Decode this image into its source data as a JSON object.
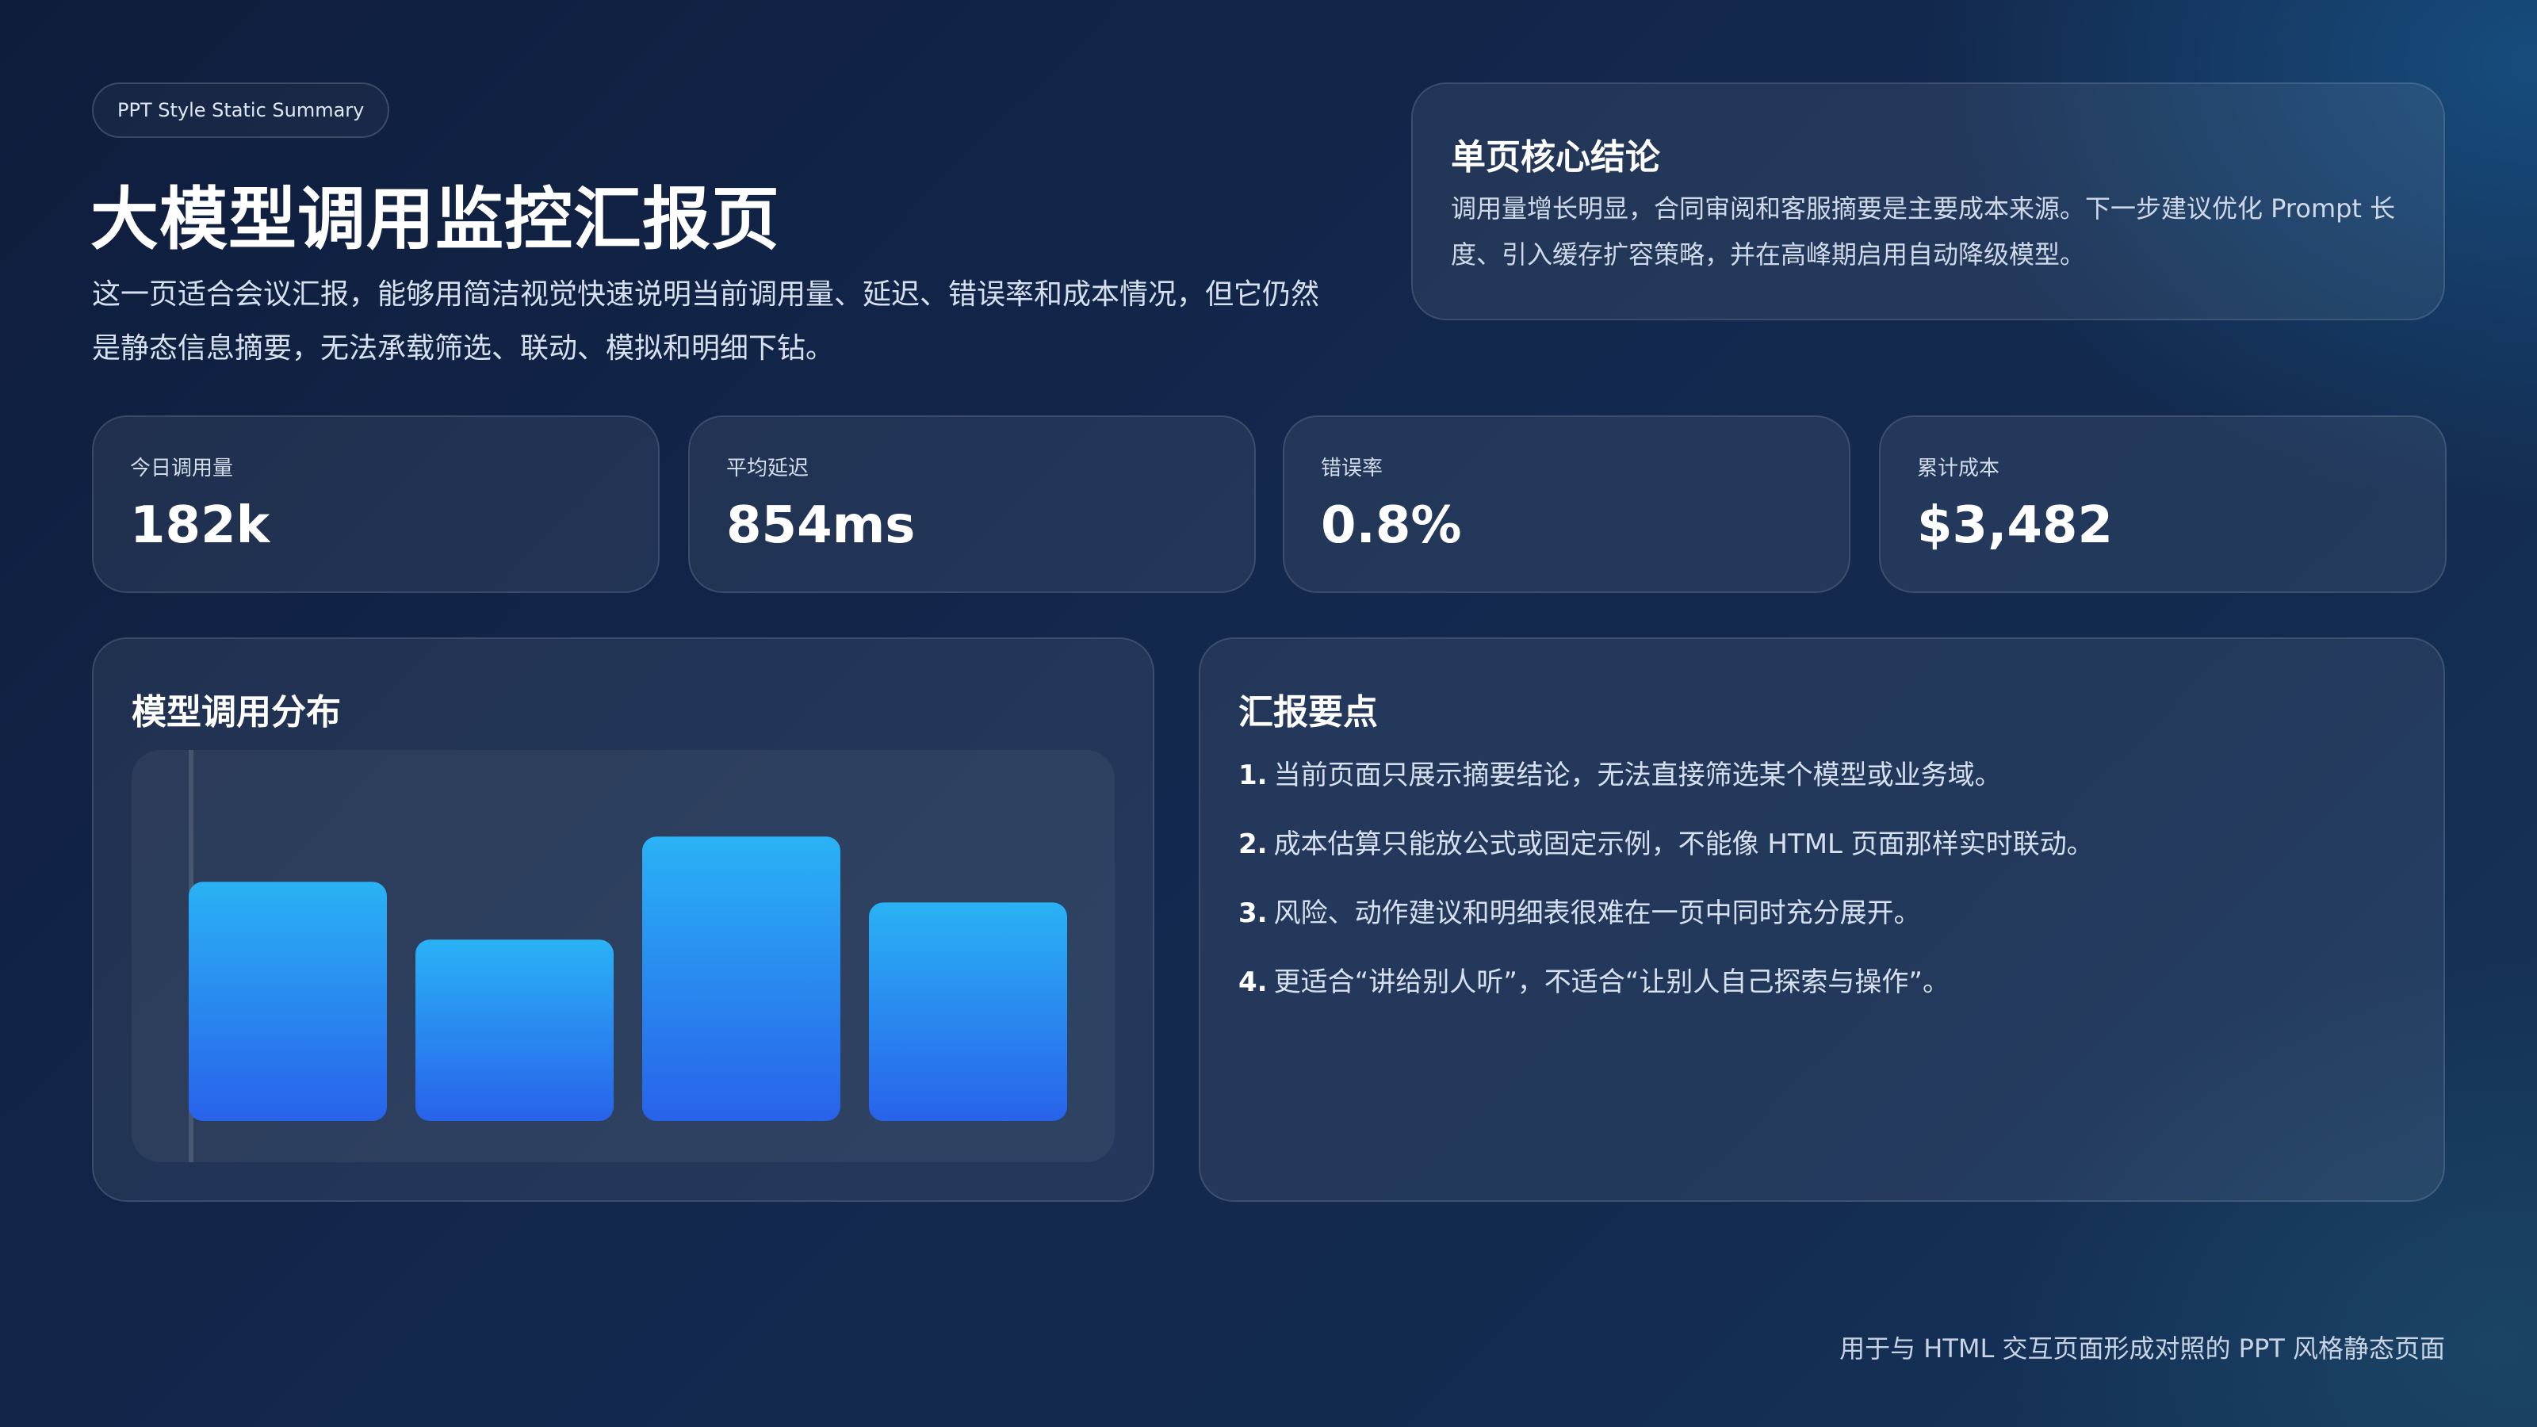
{
  "tag": "PPT Style Static Summary",
  "title": "大模型调用监控汇报页",
  "subtitle": "这一页适合会议汇报，能够用简洁视觉快速说明当前调用量、延迟、错误率和成本情况，但它仍然是静态信息摘要，无法承载筛选、联动、模拟和明细下钻。",
  "conclusion": {
    "title": "单页核心结论",
    "body": "调用量增长明显，合同审阅和客服摘要是主要成本来源。下一步建议优化 Prompt 长度、引入缓存扩容策略，并在高峰期启用自动降级模型。"
  },
  "kpis": [
    {
      "label": "今日调用量",
      "value": "182k"
    },
    {
      "label": "平均延迟",
      "value": "854ms"
    },
    {
      "label": "错误率",
      "value": "0.8%"
    },
    {
      "label": "累计成本",
      "value": "$3,482"
    }
  ],
  "chart_section": {
    "title": "模型调用分布"
  },
  "chart_data": {
    "type": "bar",
    "title": "",
    "categories": [],
    "values": [
      58,
      44,
      69,
      53
    ],
    "ylim": [
      0,
      90
    ],
    "grid": false,
    "colors": {
      "top": "#2ab2f5",
      "bottom": "#2862ea"
    }
  },
  "points": {
    "title": "汇报要点",
    "items": [
      {
        "num": "1.",
        "text": "当前页面只展示摘要结论，无法直接筛选某个模型或业务域。"
      },
      {
        "num": "2.",
        "text": "成本估算只能放公式或固定示例，不能像 HTML 页面那样实时联动。"
      },
      {
        "num": "3.",
        "text": "风险、动作建议和明细表很难在一页中同时充分展开。"
      },
      {
        "num": "4.",
        "text": "更适合“讲给别人听”，不适合“让别人自己探索与操作”。"
      }
    ]
  },
  "footer": "用于与 HTML 交互页面形成对照的 PPT 风格静态页面"
}
